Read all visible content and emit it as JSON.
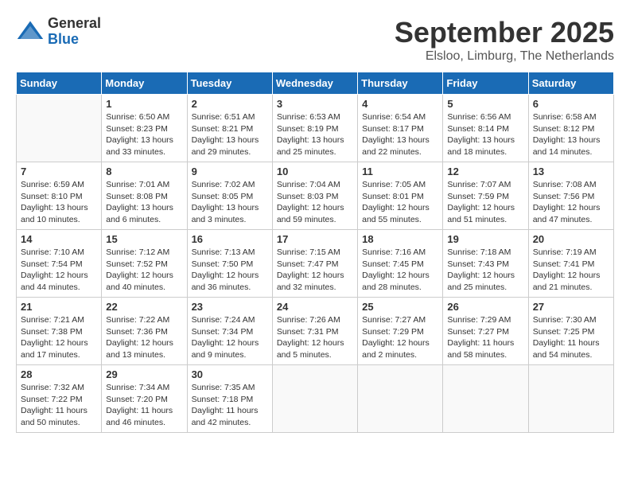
{
  "header": {
    "logo_general": "General",
    "logo_blue": "Blue",
    "month_title": "September 2025",
    "location": "Elsloo, Limburg, The Netherlands"
  },
  "weekdays": [
    "Sunday",
    "Monday",
    "Tuesday",
    "Wednesday",
    "Thursday",
    "Friday",
    "Saturday"
  ],
  "weeks": [
    [
      {
        "day": "",
        "info": ""
      },
      {
        "day": "1",
        "info": "Sunrise: 6:50 AM\nSunset: 8:23 PM\nDaylight: 13 hours\nand 33 minutes."
      },
      {
        "day": "2",
        "info": "Sunrise: 6:51 AM\nSunset: 8:21 PM\nDaylight: 13 hours\nand 29 minutes."
      },
      {
        "day": "3",
        "info": "Sunrise: 6:53 AM\nSunset: 8:19 PM\nDaylight: 13 hours\nand 25 minutes."
      },
      {
        "day": "4",
        "info": "Sunrise: 6:54 AM\nSunset: 8:17 PM\nDaylight: 13 hours\nand 22 minutes."
      },
      {
        "day": "5",
        "info": "Sunrise: 6:56 AM\nSunset: 8:14 PM\nDaylight: 13 hours\nand 18 minutes."
      },
      {
        "day": "6",
        "info": "Sunrise: 6:58 AM\nSunset: 8:12 PM\nDaylight: 13 hours\nand 14 minutes."
      }
    ],
    [
      {
        "day": "7",
        "info": "Sunrise: 6:59 AM\nSunset: 8:10 PM\nDaylight: 13 hours\nand 10 minutes."
      },
      {
        "day": "8",
        "info": "Sunrise: 7:01 AM\nSunset: 8:08 PM\nDaylight: 13 hours\nand 6 minutes."
      },
      {
        "day": "9",
        "info": "Sunrise: 7:02 AM\nSunset: 8:05 PM\nDaylight: 13 hours\nand 3 minutes."
      },
      {
        "day": "10",
        "info": "Sunrise: 7:04 AM\nSunset: 8:03 PM\nDaylight: 12 hours\nand 59 minutes."
      },
      {
        "day": "11",
        "info": "Sunrise: 7:05 AM\nSunset: 8:01 PM\nDaylight: 12 hours\nand 55 minutes."
      },
      {
        "day": "12",
        "info": "Sunrise: 7:07 AM\nSunset: 7:59 PM\nDaylight: 12 hours\nand 51 minutes."
      },
      {
        "day": "13",
        "info": "Sunrise: 7:08 AM\nSunset: 7:56 PM\nDaylight: 12 hours\nand 47 minutes."
      }
    ],
    [
      {
        "day": "14",
        "info": "Sunrise: 7:10 AM\nSunset: 7:54 PM\nDaylight: 12 hours\nand 44 minutes."
      },
      {
        "day": "15",
        "info": "Sunrise: 7:12 AM\nSunset: 7:52 PM\nDaylight: 12 hours\nand 40 minutes."
      },
      {
        "day": "16",
        "info": "Sunrise: 7:13 AM\nSunset: 7:50 PM\nDaylight: 12 hours\nand 36 minutes."
      },
      {
        "day": "17",
        "info": "Sunrise: 7:15 AM\nSunset: 7:47 PM\nDaylight: 12 hours\nand 32 minutes."
      },
      {
        "day": "18",
        "info": "Sunrise: 7:16 AM\nSunset: 7:45 PM\nDaylight: 12 hours\nand 28 minutes."
      },
      {
        "day": "19",
        "info": "Sunrise: 7:18 AM\nSunset: 7:43 PM\nDaylight: 12 hours\nand 25 minutes."
      },
      {
        "day": "20",
        "info": "Sunrise: 7:19 AM\nSunset: 7:41 PM\nDaylight: 12 hours\nand 21 minutes."
      }
    ],
    [
      {
        "day": "21",
        "info": "Sunrise: 7:21 AM\nSunset: 7:38 PM\nDaylight: 12 hours\nand 17 minutes."
      },
      {
        "day": "22",
        "info": "Sunrise: 7:22 AM\nSunset: 7:36 PM\nDaylight: 12 hours\nand 13 minutes."
      },
      {
        "day": "23",
        "info": "Sunrise: 7:24 AM\nSunset: 7:34 PM\nDaylight: 12 hours\nand 9 minutes."
      },
      {
        "day": "24",
        "info": "Sunrise: 7:26 AM\nSunset: 7:31 PM\nDaylight: 12 hours\nand 5 minutes."
      },
      {
        "day": "25",
        "info": "Sunrise: 7:27 AM\nSunset: 7:29 PM\nDaylight: 12 hours\nand 2 minutes."
      },
      {
        "day": "26",
        "info": "Sunrise: 7:29 AM\nSunset: 7:27 PM\nDaylight: 11 hours\nand 58 minutes."
      },
      {
        "day": "27",
        "info": "Sunrise: 7:30 AM\nSunset: 7:25 PM\nDaylight: 11 hours\nand 54 minutes."
      }
    ],
    [
      {
        "day": "28",
        "info": "Sunrise: 7:32 AM\nSunset: 7:22 PM\nDaylight: 11 hours\nand 50 minutes."
      },
      {
        "day": "29",
        "info": "Sunrise: 7:34 AM\nSunset: 7:20 PM\nDaylight: 11 hours\nand 46 minutes."
      },
      {
        "day": "30",
        "info": "Sunrise: 7:35 AM\nSunset: 7:18 PM\nDaylight: 11 hours\nand 42 minutes."
      },
      {
        "day": "",
        "info": ""
      },
      {
        "day": "",
        "info": ""
      },
      {
        "day": "",
        "info": ""
      },
      {
        "day": "",
        "info": ""
      }
    ]
  ]
}
